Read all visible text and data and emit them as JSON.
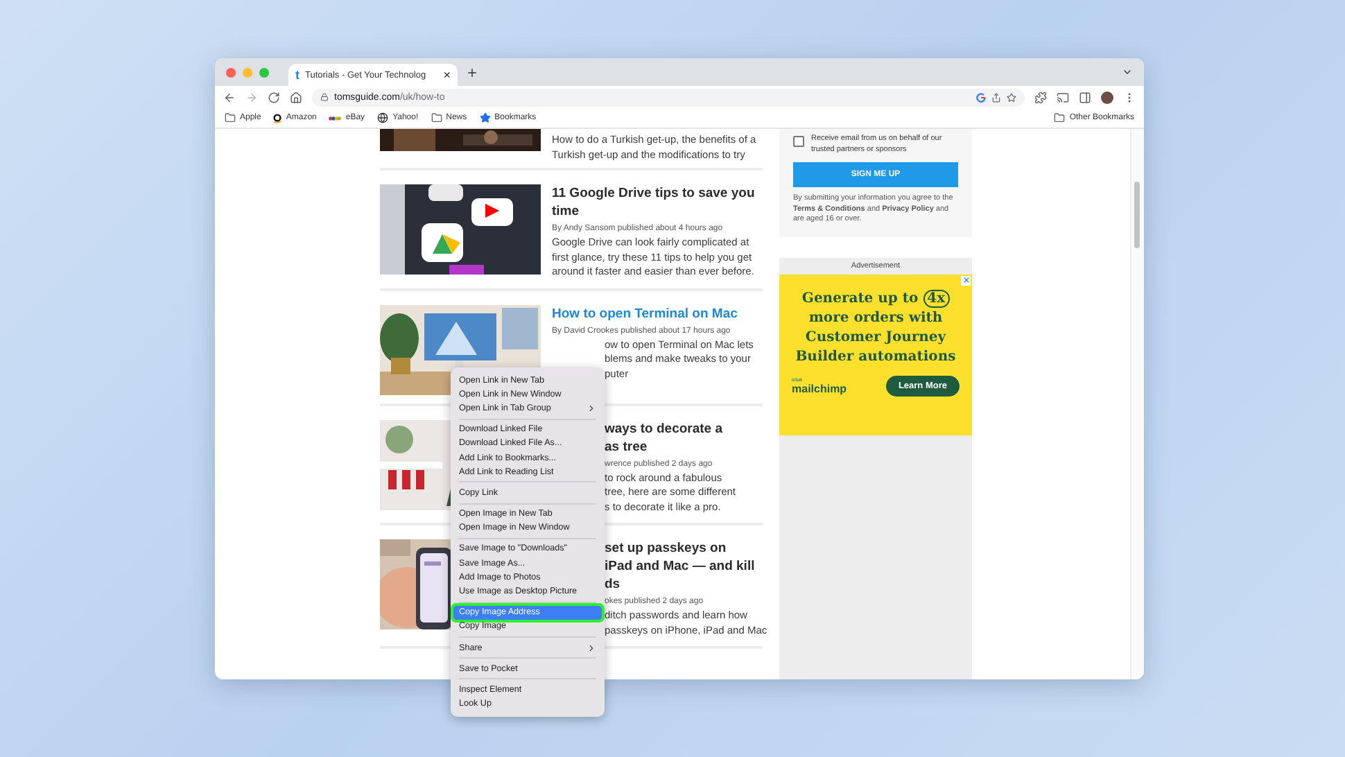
{
  "tab": {
    "favicon": "t",
    "title": "Tutorials - Get Your Technolog",
    "close": "×"
  },
  "address": {
    "host": "tomsguide.com",
    "path": "/uk/how-to"
  },
  "bookmarks": [
    {
      "label": "Apple",
      "kind": "folder"
    },
    {
      "label": "Amazon",
      "kind": "amazon"
    },
    {
      "label": "eBay",
      "kind": "ebay"
    },
    {
      "label": "Yahoo!",
      "kind": "globe"
    },
    {
      "label": "News",
      "kind": "folder"
    },
    {
      "label": "Bookmarks",
      "kind": "star"
    }
  ],
  "other_bookmarks": "Other Bookmarks",
  "articles": [
    {
      "kind": "cut",
      "excerpt": "How to do a Turkish get-up, the benefits of a Turkish get-up and the modifications to try"
    },
    {
      "kind": "full",
      "title": "11 Google Drive tips to save you time",
      "link": false,
      "byline": "By Andy Sansom published about 4 hours ago",
      "excerpt": "Google Drive can look fairly complicated at first glance, try these 11 tips to help you get around it faster and easier than ever before."
    },
    {
      "kind": "covered",
      "title_lines": [
        "How to open Terminal on Mac"
      ],
      "link": true,
      "byline_line": "By David Crookes published about 17 hours ago",
      "excerpt_lines": [
        "ow to open Terminal on Mac lets",
        "blems and make tweaks to your",
        "puter"
      ]
    },
    {
      "kind": "covered",
      "title_lines": [
        "ways to decorate a",
        "as tree"
      ],
      "link": false,
      "byline_line": "wrence published 2 days ago",
      "excerpt_lines": [
        "to rock around a fabulous",
        "tree, here are some different",
        "s to decorate it like a pro."
      ]
    },
    {
      "kind": "covered",
      "title_lines": [
        "set up passkeys on",
        "iPad and Mac — and kill",
        "ds"
      ],
      "link": false,
      "byline_line": "okes published 2 days ago",
      "excerpt_lines": [
        "ditch passwords and learn how",
        "passkeys on iPhone, iPad and Mac"
      ]
    }
  ],
  "newsletter": {
    "consent": "Receive email from us on behalf of our trusted partners or sponsors",
    "checked": false,
    "button": "SIGN ME UP",
    "fine_print": "By submitting your information you agree to the **Terms & Conditions** and **Privacy Policy** and are aged 16 or over."
  },
  "ad": {
    "label": "Advertisement",
    "headline_before": "Generate up to",
    "badge": "4x",
    "headline_after": "more orders with Customer Journey Builder automations",
    "brand_small": "intuit",
    "brand": "mailchimp",
    "button": "Learn More"
  },
  "menu": {
    "groups": [
      [
        {
          "label": "Open Link in New Tab",
          "submenu": false,
          "selected": false
        },
        {
          "label": "Open Link in New Window",
          "submenu": false,
          "selected": false
        },
        {
          "label": "Open Link in Tab Group",
          "submenu": true,
          "selected": false
        }
      ],
      [
        {
          "label": "Download Linked File",
          "submenu": false,
          "selected": false
        },
        {
          "label": "Download Linked File As...",
          "submenu": false,
          "selected": false
        },
        {
          "label": "Add Link to Bookmarks...",
          "submenu": false,
          "selected": false
        },
        {
          "label": "Add Link to Reading List",
          "submenu": false,
          "selected": false
        }
      ],
      [
        {
          "label": "Copy Link",
          "submenu": false,
          "selected": false
        }
      ],
      [
        {
          "label": "Open Image in New Tab",
          "submenu": false,
          "selected": false
        },
        {
          "label": "Open Image in New Window",
          "submenu": false,
          "selected": false
        }
      ],
      [
        {
          "label": "Save Image to \"Downloads\"",
          "submenu": false,
          "selected": false
        },
        {
          "label": "Save Image As...",
          "submenu": false,
          "selected": false
        },
        {
          "label": "Add Image to Photos",
          "submenu": false,
          "selected": false
        },
        {
          "label": "Use Image as Desktop Picture",
          "submenu": false,
          "selected": false
        }
      ],
      [
        {
          "label": "Copy Image Address",
          "submenu": false,
          "selected": true
        },
        {
          "label": "Copy Image",
          "submenu": false,
          "selected": false
        }
      ],
      [
        {
          "label": "Share",
          "submenu": true,
          "selected": false
        }
      ],
      [
        {
          "label": "Save to Pocket",
          "submenu": false,
          "selected": false
        }
      ],
      [
        {
          "label": "Inspect Element",
          "submenu": false,
          "selected": false
        },
        {
          "label": "Look Up",
          "submenu": false,
          "selected": false
        }
      ]
    ]
  }
}
